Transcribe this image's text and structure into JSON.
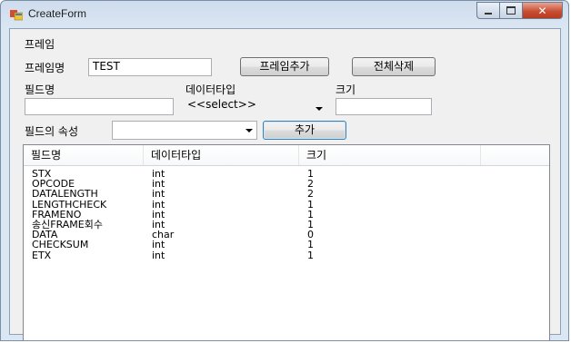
{
  "window": {
    "title": "CreateForm"
  },
  "group": {
    "label": "프레임"
  },
  "frame": {
    "name_label": "프레임명",
    "name_value": "TEST",
    "add_label": "프레임추가",
    "delete_all_label": "전체삭제"
  },
  "field": {
    "name_label": "필드명",
    "name_value": "",
    "type_label": "데이터타입",
    "type_value": "<<select>>",
    "size_label": "크기",
    "size_value": "",
    "attr_label": "필드의 속성",
    "attr_value": "",
    "add_label": "추가"
  },
  "list": {
    "columns": [
      "필드명",
      "데이터타입",
      "크기",
      ""
    ],
    "rows": [
      [
        "STX",
        "int",
        "1"
      ],
      [
        "OPCODE",
        "int",
        "2"
      ],
      [
        "DATALENGTH",
        "int",
        "2"
      ],
      [
        "LENGTHCHECK",
        "int",
        "1"
      ],
      [
        "FRAMENO",
        "int",
        "1"
      ],
      [
        "송신FRAME회수",
        "int",
        "1"
      ],
      [
        "DATA",
        "char",
        "0"
      ],
      [
        "CHECKSUM",
        "int",
        "1"
      ],
      [
        "ETX",
        "int",
        "1"
      ]
    ]
  }
}
